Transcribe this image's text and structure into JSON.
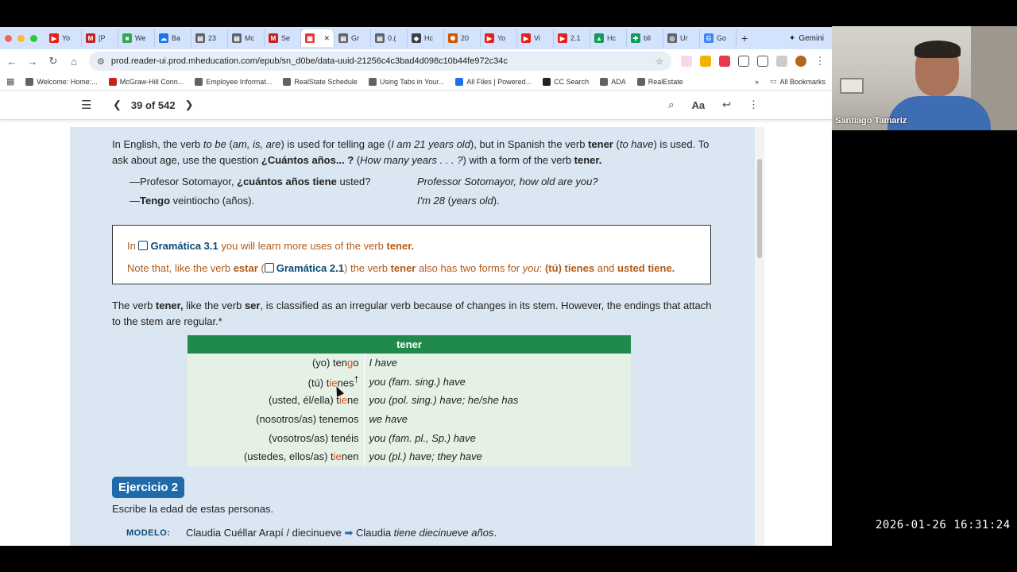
{
  "browser": {
    "tabs": [
      {
        "label": "Yo",
        "color": "#e62117",
        "glyph": "▶"
      },
      {
        "label": "[P",
        "color": "#c5221f",
        "glyph": "M"
      },
      {
        "label": "We",
        "color": "#34a853",
        "glyph": "■"
      },
      {
        "label": "Ba",
        "color": "#1a73e8",
        "glyph": "☁"
      },
      {
        "label": "23",
        "color": "#5f6368",
        "glyph": "▤"
      },
      {
        "label": "Mc",
        "color": "#5f6368",
        "glyph": "▤"
      },
      {
        "label": "Se",
        "color": "#c5221f",
        "glyph": "M"
      },
      {
        "label": "",
        "color": "#e53935",
        "glyph": "▦"
      },
      {
        "label": "Gr",
        "color": "#5f6368",
        "glyph": "▤"
      },
      {
        "label": "0.(",
        "color": "#5f6368",
        "glyph": "▤"
      },
      {
        "label": "Hc",
        "color": "#3c4043",
        "glyph": "◆"
      },
      {
        "label": "20",
        "color": "#d35400",
        "glyph": "✺"
      },
      {
        "label": "Yo",
        "color": "#e62117",
        "glyph": "▶"
      },
      {
        "label": "Vi",
        "color": "#e62117",
        "glyph": "▶"
      },
      {
        "label": "2.1",
        "color": "#e62117",
        "glyph": "▶"
      },
      {
        "label": "Hc",
        "color": "#0f9d58",
        "glyph": "▲"
      },
      {
        "label": "bll",
        "color": "#0f9d58",
        "glyph": "✚"
      },
      {
        "label": "Ur",
        "color": "#5f6368",
        "glyph": "◎"
      },
      {
        "label": "Go",
        "color": "#4285f4",
        "glyph": "G"
      }
    ],
    "gemini_label": "Gemini",
    "url": "prod.reader-ui.prod.mheducation.com/epub/sn_d0be/data-uuid-21256c4c3bad4d098c10b44fe972c34c",
    "bookmarks": [
      {
        "label": "Welcome: Home:...",
        "color": "#5f6368"
      },
      {
        "label": "McGraw-Hill Conn...",
        "color": "#c5221f"
      },
      {
        "label": "Employee Informat...",
        "color": "#5f6368"
      },
      {
        "label": "RealState Schedule",
        "color": "#5f6368"
      },
      {
        "label": "Using Tabs in Your...",
        "color": "#5f6368"
      },
      {
        "label": "All Files | Powered...",
        "color": "#1a73e8"
      },
      {
        "label": "CC Search",
        "color": "#222222"
      },
      {
        "label": "ADA",
        "color": "#5f6368"
      },
      {
        "label": "RealEstate",
        "color": "#5f6368"
      }
    ],
    "more_bookmarks": "»",
    "all_bookmarks": "All Bookmarks"
  },
  "reader": {
    "page_indicator": "39 of 542"
  },
  "content": {
    "intro_html": "In English, the verb <i>to be</i> (<i>am, is, are</i>) is used for telling age (<i>I am 21 years old</i>), but in Spanish the verb <b>tener</b> (<i>to have</i>) is used. To ask about age, use the question <b>¿Cuántos años... ?</b> (<i>How many years . . . ?</i>) with a form of the verb <b>tener.</b>",
    "dialog": [
      {
        "es_html": "—Profesor Sotomayor, <b>¿cuántos años tiene</b> usted?",
        "en": "Professor Sotomayor, how old are you?"
      },
      {
        "es_html": "—<b>Tengo</b> veintiocho (años).",
        "en_html": "<i>I'm 28</i> (<i>years old</i>)."
      }
    ],
    "note_line1": {
      "pre": "In",
      "link": "Gramática 3.1",
      "post": "you will learn more uses of the verb",
      "verb": "tener."
    },
    "note_line2": {
      "pre": "Note that, like the verb",
      "verb1": "estar",
      "link": "Gramática 2.1",
      "mid": ") the verb",
      "verb2": "tener",
      "mid2": "also has two forms for",
      "you": "you",
      "forms_a": "(tú) tienes",
      "and": "and",
      "forms_b": "usted tiene."
    },
    "stem_paragraph_html": "The verb <b>tener,</b> like the verb <b>ser</b>, is classified as an irregular verb because of changes in its stem. However, the endings that attach to the stem are regular.*",
    "table": {
      "header": "tener",
      "rows": [
        {
          "left_html": "(yo) ten<span class=\"stem\">g</span>o",
          "right": "I have"
        },
        {
          "left_html": "(tú) t<span class=\"stem\">ie</span>nes<sup>†</sup>",
          "right": "you (fam. sing.) have"
        },
        {
          "left_html": "(usted, él/ella) t<span class=\"stem\">ie</span>ne",
          "right": "you (pol. sing.) have; he/she has"
        },
        {
          "left_html": "(nosotros/as) tenemos",
          "right": "we have"
        },
        {
          "left_html": "(vosotros/as) tenéis",
          "right": "you (fam. pl., Sp.) have"
        },
        {
          "left_html": "(ustedes, ellos/as) t<span class=\"stem\">ie</span>nen",
          "right": "you (pl.) have; they have"
        }
      ]
    },
    "exercise_title": "Ejercicio 2",
    "exercise_instruction": "Escribe la edad de estas personas.",
    "modelo_label": "MODELO:",
    "modelo_html": "Claudia Cuéllar Arapí / diecinueve <span style=\"color:#1f6aa8\">➡</span> Claudia <i>tiene diecinueve años</i>."
  },
  "video": {
    "participant_name": "Santiago Tamariz"
  },
  "timestamp": "2026-01-26 16:31:24"
}
